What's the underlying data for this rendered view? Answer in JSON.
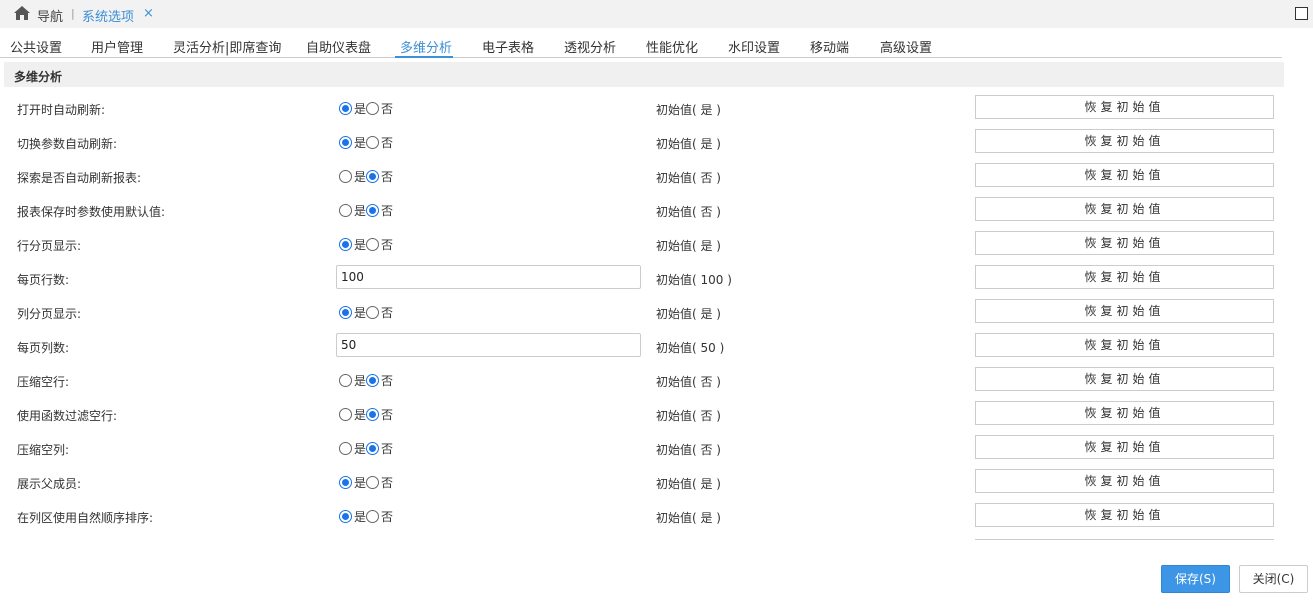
{
  "topbar": {
    "nav_label": "导航",
    "separator": "|",
    "active_tab": "系统选项",
    "close_glyph": "×"
  },
  "tabs": [
    {
      "label": "公共设置",
      "active": false
    },
    {
      "label": "用户管理",
      "active": false
    },
    {
      "label": "灵活分析|即席查询",
      "active": false
    },
    {
      "label": "自助仪表盘",
      "active": false
    },
    {
      "label": "多维分析",
      "active": true
    },
    {
      "label": "电子表格",
      "active": false
    },
    {
      "label": "透视分析",
      "active": false
    },
    {
      "label": "性能优化",
      "active": false
    },
    {
      "label": "水印设置",
      "active": false
    },
    {
      "label": "移动端",
      "active": false
    },
    {
      "label": "高级设置",
      "active": false
    }
  ],
  "section": {
    "title": "多维分析"
  },
  "radio_labels": {
    "yes": "是",
    "no": "否"
  },
  "reset_label": "恢复初始值",
  "rows": [
    {
      "label": "打开时自动刷新:",
      "type": "radio",
      "value": "yes",
      "initial": "初始值( 是 )"
    },
    {
      "label": "切换参数自动刷新:",
      "type": "radio",
      "value": "yes",
      "initial": "初始值( 是 )"
    },
    {
      "label": "探索是否自动刷新报表:",
      "type": "radio",
      "value": "no",
      "initial": "初始值( 否 )"
    },
    {
      "label": "报表保存时参数使用默认值:",
      "type": "radio",
      "value": "no",
      "initial": "初始值( 否 )"
    },
    {
      "label": "行分页显示:",
      "type": "radio",
      "value": "yes",
      "initial": "初始值( 是 )"
    },
    {
      "label": "每页行数:",
      "type": "input",
      "value": "100",
      "initial": "初始值( 100 )"
    },
    {
      "label": "列分页显示:",
      "type": "radio",
      "value": "yes",
      "initial": "初始值( 是 )"
    },
    {
      "label": "每页列数:",
      "type": "input",
      "value": "50",
      "initial": "初始值( 50 )"
    },
    {
      "label": "压缩空行:",
      "type": "radio",
      "value": "no",
      "initial": "初始值( 否 )"
    },
    {
      "label": "使用函数过滤空行:",
      "type": "radio",
      "value": "no",
      "initial": "初始值( 否 )"
    },
    {
      "label": "压缩空列:",
      "type": "radio",
      "value": "no",
      "initial": "初始值( 否 )"
    },
    {
      "label": "展示父成员:",
      "type": "radio",
      "value": "yes",
      "initial": "初始值( 是 )"
    },
    {
      "label": "在列区使用自然顺序排序:",
      "type": "radio",
      "value": "yes",
      "initial": "初始值( 是 )"
    }
  ],
  "footer": {
    "save_label": "保存(S)",
    "close_label": "关闭(C)"
  },
  "colors": {
    "accent": "#3d8fd6",
    "radio_on": "#1a73e8"
  }
}
